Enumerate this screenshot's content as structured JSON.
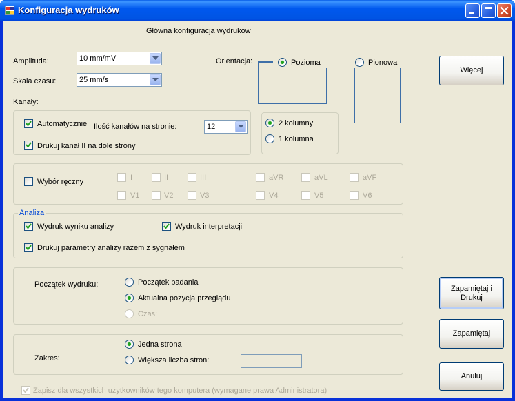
{
  "window": {
    "title": "Konfiguracja wydruków"
  },
  "caption_buttons": {
    "minimize": "minimize-icon",
    "maximize": "maximize-icon",
    "close": "close-icon"
  },
  "header": "Główna konfiguracja wydruków",
  "amplitude": {
    "label": "Amplituda:",
    "value": "10 mm/mV"
  },
  "timescale": {
    "label": "Skala czasu:",
    "value": "25 mm/s"
  },
  "orientation": {
    "label": "Orientacja:",
    "options": [
      "Pozioma",
      "Pionowa"
    ],
    "selected": "Pozioma"
  },
  "channels": {
    "label": "Kanały:",
    "automatic": {
      "label": "Automatycznie",
      "checked": true
    },
    "count_label": "Ilość kanałów na stronie:",
    "count_value": "12",
    "print_channel2": {
      "label": "Drukuj kanał II na dole strony",
      "checked": true
    }
  },
  "columns": {
    "options": [
      "2 kolumny",
      "1 kolumna"
    ],
    "selected": "2 kolumny"
  },
  "manual": {
    "label": "Wybór ręczny",
    "checked": false,
    "leads_row1": [
      "I",
      "II",
      "III",
      "aVR",
      "aVL",
      "aVF"
    ],
    "leads_row2": [
      "V1",
      "V2",
      "V3",
      "V4",
      "V5",
      "V6"
    ]
  },
  "analysis": {
    "legend": "Analiza",
    "print_result": {
      "label": "Wydruk wyniku analizy",
      "checked": true
    },
    "print_interpretation": {
      "label": "Wydruk interpretacji",
      "checked": true
    },
    "print_params": {
      "label": "Drukuj parametry analizy razem z sygnałem",
      "checked": true
    }
  },
  "start": {
    "label": "Początek wydruku:",
    "options": [
      "Początek badania",
      "Aktualna pozycja przeglądu",
      "Czas:"
    ],
    "selected": "Aktualna pozycja przeglądu"
  },
  "range": {
    "label": "Zakres:",
    "options": [
      "Jedna strona",
      "Większa liczba stron:"
    ],
    "selected": "Jedna strona",
    "pages_value": ""
  },
  "save_all": {
    "label": "Zapisz dla wszystkich użytkowników tego komputera (wymagane prawa Administratora)",
    "checked": true
  },
  "buttons": {
    "more": "Więcej",
    "save_print_line1": "Zapamiętaj i",
    "save_print_line2": "Drukuj",
    "save": "Zapamiętaj",
    "cancel": "Anuluj"
  },
  "colors": {
    "titlebar": "#0054e3",
    "dialog_bg": "#ece9d8",
    "radio_dot": "#21a121",
    "group_border_blue": "#3e6fa8"
  }
}
